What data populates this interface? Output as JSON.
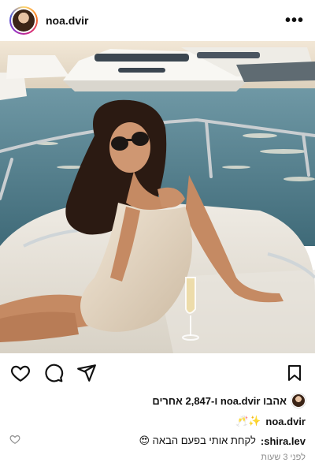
{
  "post": {
    "username": "noa.dvir",
    "more_icon": "more-horizontal-icon",
    "photo_alt": "Woman in sunglasses and satin dress sitting on yacht deck with champagne glass, marina in background"
  },
  "actions": {
    "like_icon": "heart-icon",
    "comment_icon": "comment-icon",
    "share_icon": "send-icon",
    "save_icon": "bookmark-icon"
  },
  "likes": {
    "text": "אהבו noa.dvir ו-2,847 אחרים"
  },
  "caption": {
    "username": "noa.dvir",
    "text": "✨🥂"
  },
  "comment": {
    "username": "shira.lev:",
    "text": "לקחת אותי בפעם הבאה 😍"
  },
  "timestamp": "לפני 3 שעות",
  "colors": {
    "sea": "#5d8c9b",
    "deck": "#e8e4dc",
    "dress": "#e9dccb",
    "skin": "#c98f67"
  }
}
